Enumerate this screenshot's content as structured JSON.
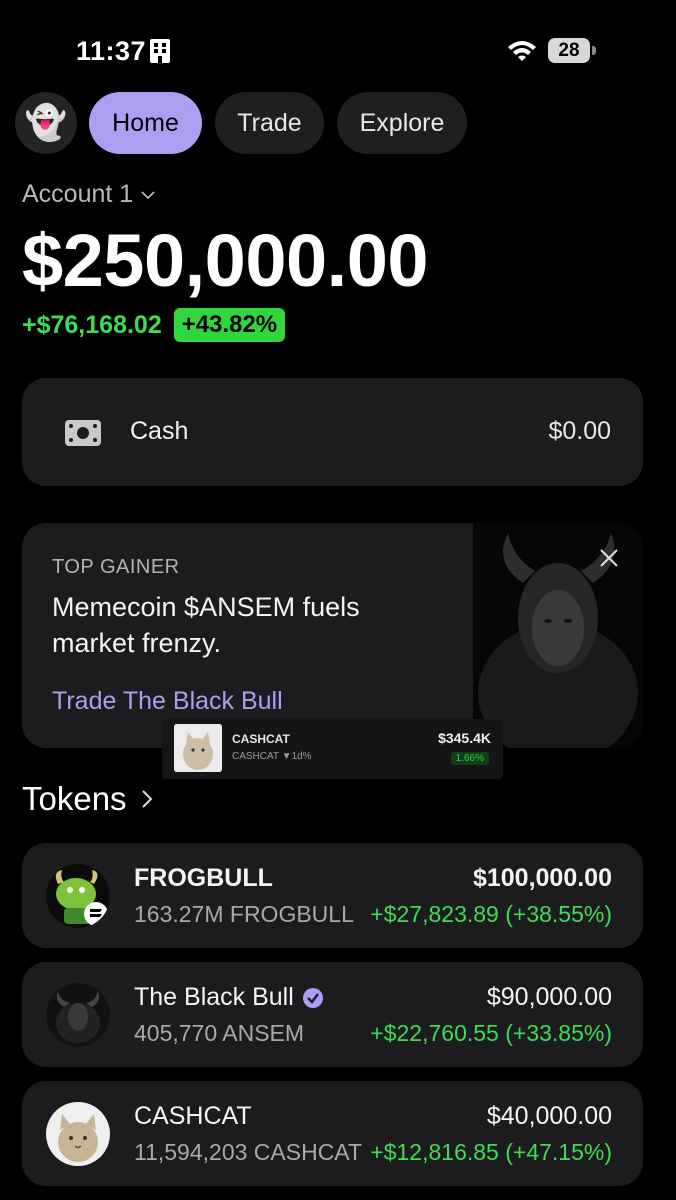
{
  "status_bar": {
    "time": "11:37",
    "battery": "28"
  },
  "nav": {
    "avatar": "👻",
    "tabs": [
      {
        "label": "Home",
        "active": true
      },
      {
        "label": "Trade",
        "active": false
      },
      {
        "label": "Explore",
        "active": false
      }
    ]
  },
  "account": {
    "name": "Account 1",
    "balance": "$250,000.00",
    "change_amount": "+$76,168.02",
    "change_percent": "+43.82%"
  },
  "cash": {
    "label": "Cash",
    "value": "$0.00"
  },
  "promo": {
    "tag": "TOP GAINER",
    "title": "Memecoin $ANSEM fuels market frenzy.",
    "link": "Trade The Black Bull"
  },
  "mini_popup": {
    "name": "CASHCAT",
    "sub": "CASHCAT  ▼1d%",
    "price": "$345.4K",
    "change": "1.66%"
  },
  "tokens": {
    "heading": "Tokens",
    "items": [
      {
        "name": "FROGBULL",
        "qty": "163.27M FROGBULL",
        "value": "$100,000.00",
        "change": "+$27,823.89 (+38.55%)",
        "verified": false
      },
      {
        "name": "The Black Bull",
        "qty": "405,770 ANSEM",
        "value": "$90,000.00",
        "change": "+$22,760.55 (+33.85%)",
        "verified": true
      },
      {
        "name": "CASHCAT",
        "qty": "11,594,203 CASHCAT",
        "value": "$40,000.00",
        "change": "+$12,816.85 (+47.15%)",
        "verified": false
      }
    ]
  },
  "colors": {
    "accent": "#ab9ff2",
    "positive": "#3edc53",
    "card": "#1c1c1e"
  }
}
